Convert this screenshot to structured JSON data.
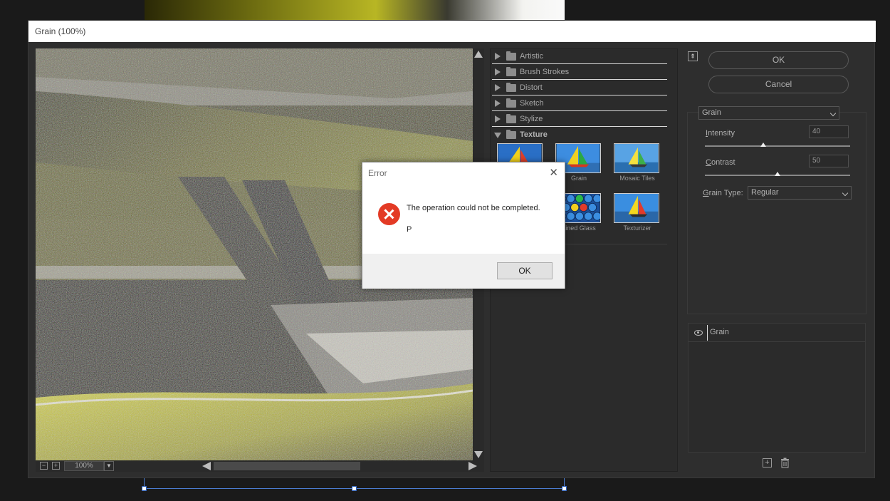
{
  "window": {
    "title": "Grain (100%)"
  },
  "preview": {
    "zoom": "100%"
  },
  "gallery": {
    "categories": [
      {
        "label": "Artistic"
      },
      {
        "label": "Brush Strokes"
      },
      {
        "label": "Distort"
      },
      {
        "label": "Sketch"
      },
      {
        "label": "Stylize"
      },
      {
        "label": "Texture"
      }
    ],
    "thumbnails": [
      {
        "label": ""
      },
      {
        "label": "Grain"
      },
      {
        "label": "Mosaic Tiles"
      },
      {
        "label": "ained Glass"
      },
      {
        "label": "Texturizer"
      }
    ]
  },
  "actions": {
    "ok": "OK",
    "cancel": "Cancel"
  },
  "settings": {
    "filter": "Grain",
    "intensity_label_u": "I",
    "intensity_label_rest": "ntensity",
    "intensity_value": "40",
    "intensity_level": 40,
    "contrast_label_u": "C",
    "contrast_label_rest": "ontrast",
    "contrast_value": "50",
    "contrast_level": 50,
    "grain_type_label_u": "G",
    "grain_type_label_rest": "rain Type:",
    "grain_type": "Regular"
  },
  "layers": [
    {
      "name": "Grain"
    }
  ],
  "error_dialog": {
    "title": "Error",
    "close": "✕",
    "message": "The operation could not be completed.",
    "detail": "P",
    "ok": "OK"
  },
  "colors": {
    "accent": "#e33a25",
    "selection": "#4a7bd0"
  }
}
